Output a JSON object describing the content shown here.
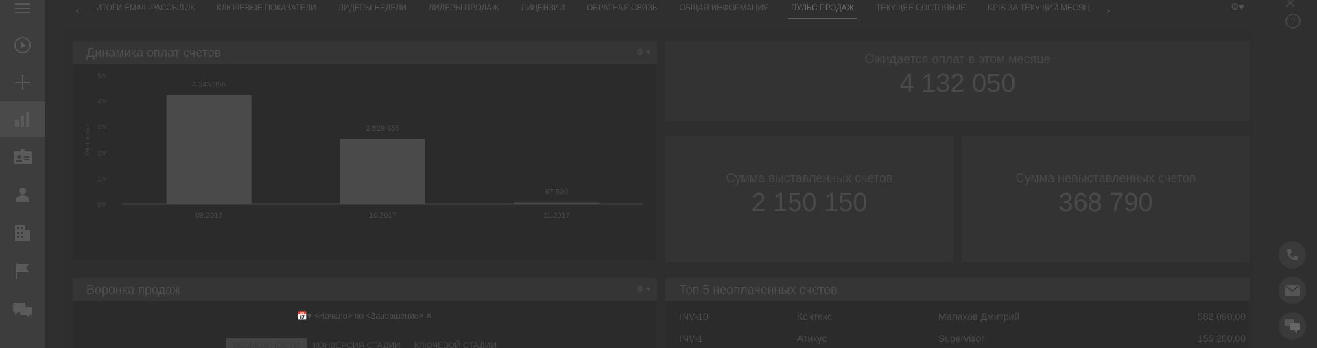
{
  "sidebar": {
    "items": [
      {
        "name": "menu-icon"
      },
      {
        "name": "play-circle-icon"
      },
      {
        "name": "plus-icon"
      },
      {
        "name": "bar-chart-icon",
        "active": true
      },
      {
        "name": "contact-card-icon"
      },
      {
        "name": "user-icon"
      },
      {
        "name": "building-icon"
      },
      {
        "name": "flag-icon"
      },
      {
        "name": "chat-icon"
      }
    ]
  },
  "tabs": [
    "ИТОГИ EMAIL-РАССЫЛОК",
    "КЛЮЧЕВЫЕ ПОКАЗАТЕЛИ",
    "ЛИДЕРЫ НЕДЕЛИ",
    "ЛИДЕРЫ ПРОДАЖ",
    "ЛИЦЕНЗИИ",
    "ОБРАТНАЯ СВЯЗЬ",
    "ОБЩАЯ ИНФОРМАЦИЯ",
    "ПУЛЬС ПРОДАЖ",
    "ТЕКУЩЕЕ СОСТОЯНИЕ",
    "KPIS ЗА ТЕКУЩИЙ МЕСЯЦ"
  ],
  "active_tab": "ПУЛЬС ПРОДАЖ",
  "payments_widget": {
    "title": "Динамика оплат счетов"
  },
  "chart_data": {
    "type": "bar",
    "categories": [
      "09.2017",
      "10.2017",
      "11.2017"
    ],
    "values": [
      4245356,
      2529655,
      67500
    ],
    "labels": [
      "4 245 356",
      "2 529 655",
      "67 500"
    ],
    "ylabel": "Факт оплат",
    "yticks": [
      "0M",
      "1M",
      "2M",
      "3M",
      "4M",
      "5M"
    ],
    "ylim": [
      0,
      5000000
    ],
    "color": "#4a4a4a"
  },
  "kpi_expected": {
    "label": "Ожидается оплат в этом месяце",
    "value": "4 132 050"
  },
  "kpi_issued": {
    "label": "Сумма выставленных счетов",
    "value": "2 150 150"
  },
  "kpi_not_issued": {
    "label": "Сумма невыставленных счетов",
    "value": "368 790"
  },
  "funnel_widget": {
    "title": "Воронка продаж",
    "range": "<Начало> по <Завершение>",
    "buttons": [
      "ВОЗМОЖНОСТИ",
      "КОНВЕРСИЯ СТАДИИ",
      "КЛЮЧЕВОЙ СТАДИИ"
    ]
  },
  "unpaid_widget": {
    "title": "Топ 5 неоплаченных счетов",
    "rows": [
      {
        "id": "INV-10",
        "account": "Контекс",
        "owner": "Малахов Дмитрий",
        "amount": "582 090,00"
      },
      {
        "id": "INV-1",
        "account": "Атикус",
        "owner": "Supervisor",
        "amount": "155 200,00"
      }
    ]
  }
}
